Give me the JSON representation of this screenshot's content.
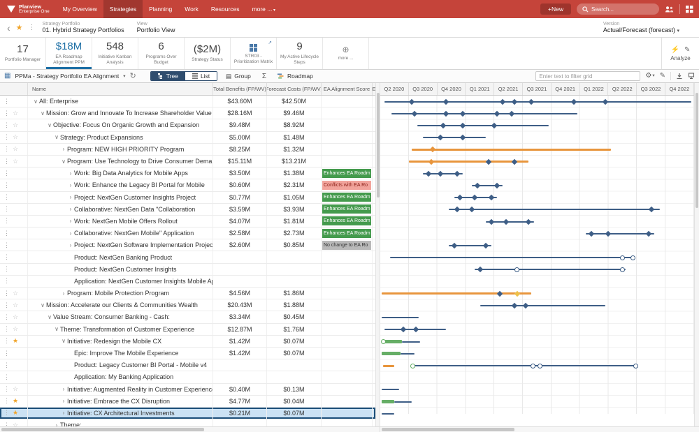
{
  "colors": {
    "nav_red": "#C5443A",
    "nav_red_dark": "#9E342C",
    "accent_blue": "#1D6FA5",
    "tree_active": "#2F4D6E",
    "selected_row_bg": "#CBE2F4",
    "selected_row_border": "#1C4F7A",
    "star_orange": "#F0A42A",
    "badge_green": "#449A4D",
    "badge_red": "#F2A49C",
    "badge_gray": "#B9B9B9",
    "navy": "#3E5E86",
    "orange": "#E8953C",
    "green": "#66AE66",
    "yellow": "#EEC04A"
  },
  "icons": {
    "kebab": "⋮",
    "star_filled": "★",
    "star_outline": "☆",
    "back": "‹",
    "caret_down": "▾",
    "expanded": "∨",
    "collapsed": "›",
    "refresh": "↻",
    "gear": "⚙",
    "pencil": "✎",
    "sigma": "Σ",
    "external": "↗",
    "plus_circle": "⊕",
    "grid": "▦",
    "group": "▤",
    "wand": "⚡"
  },
  "nav": {
    "logo_line1": "Planview",
    "logo_line2": "Enterprise One",
    "items": [
      {
        "label": "My Overview"
      },
      {
        "label": "Strategies",
        "active": true
      },
      {
        "label": "Planning"
      },
      {
        "label": "Work"
      },
      {
        "label": "Resources"
      },
      {
        "label": "more ...",
        "caret": true
      }
    ],
    "new_button": "+New",
    "search_placeholder": "Search..."
  },
  "breadcrumb": {
    "portfolio_label": "Strategy Portfolio",
    "portfolio_value": "01. Hybrid Strategy Portfolios",
    "view_label": "View",
    "view_value": "Portfolio View",
    "version_label": "Version",
    "version_value": "Actual/Forecast (forecast)"
  },
  "tiles": [
    {
      "value": "17",
      "label": "Portfolio Manager"
    },
    {
      "value": "$18M",
      "label": "EA Roadmap Alignment PPM",
      "selected": true
    },
    {
      "value": "548",
      "label": "Initiative Kanban Analysis"
    },
    {
      "value": "6",
      "label": "Programs Over Budget"
    },
    {
      "value": "($2M)",
      "label": "Strategy Status"
    },
    {
      "value": "",
      "label": "STR03 - Prioritization Matrix",
      "icon": "matrix"
    },
    {
      "value": "9",
      "label": "My Active Lifecycle Steps"
    },
    {
      "value": "",
      "label": "more ...",
      "icon": "plus"
    }
  ],
  "analyze_label": "Analyze",
  "toolbar": {
    "grid_view_label": "PPMa - Strategy Portfolio EA Alignment",
    "tree_label": "Tree",
    "list_label": "List",
    "group_label": "Group",
    "roadmap_label": "Roadmap",
    "filter_placeholder": "Enter text to filter grid"
  },
  "grid": {
    "columns": [
      "Name",
      "Total Benefits (FP/WV)",
      "Forecast Costs (FP/WV)",
      "EA Alignment Score",
      "E"
    ],
    "rows": [
      {
        "name": "All: Enterprise",
        "level": 0,
        "arrow": "v",
        "star": "none",
        "benefits": "$43.60M",
        "costs": "$42.50M",
        "ea": null
      },
      {
        "name": "Mission: Grow and Innovate To Increase Shareholder Value",
        "level": 1,
        "arrow": "v",
        "star": "outline",
        "benefits": "$28.16M",
        "costs": "$9.46M",
        "ea": null
      },
      {
        "name": "Objective: Focus On Organic Growth and Expansion",
        "level": 2,
        "arrow": "v",
        "star": "outline",
        "benefits": "$9.48M",
        "costs": "$8.92M",
        "ea": null
      },
      {
        "name": "Strategy: Product Expansions",
        "level": 3,
        "arrow": "v",
        "star": "outline",
        "benefits": "$5.00M",
        "costs": "$1.48M",
        "ea": null
      },
      {
        "name": "Program: NEW HIGH PRIORITY Program",
        "level": 4,
        "arrow": "r",
        "star": "outline",
        "benefits": "$8.25M",
        "costs": "$1.32M",
        "ea": null
      },
      {
        "name": "Program: Use Technology to Drive Consumer Demand",
        "level": 4,
        "arrow": "v",
        "star": "outline",
        "benefits": "$15.11M",
        "costs": "$13.21M",
        "ea": null
      },
      {
        "name": "Work: Big Data Analytics for Mobile Apps",
        "level": 5,
        "arrow": "r",
        "star": "none",
        "benefits": "$3.50M",
        "costs": "$1.38M",
        "ea": {
          "text": "Enhances EA Roadm",
          "kind": "green"
        }
      },
      {
        "name": "Work: Enhance the Legacy BI Portal for Mobile",
        "level": 5,
        "arrow": "r",
        "star": "none",
        "benefits": "$0.60M",
        "costs": "$2.31M",
        "ea": {
          "text": "Conflicts with EA Ro",
          "kind": "red"
        }
      },
      {
        "name": "Project: NextGen Customer Insights Project",
        "level": 5,
        "arrow": "r",
        "star": "none",
        "benefits": "$0.77M",
        "costs": "$1.05M",
        "ea": {
          "text": "Enhances EA Roadm",
          "kind": "green"
        }
      },
      {
        "name": "Collaborative: NextGen Data \"Collaboration",
        "level": 5,
        "arrow": "r",
        "star": "none",
        "benefits": "$3.59M",
        "costs": "$3.93M",
        "ea": {
          "text": "Enhances EA Roadm",
          "kind": "green"
        }
      },
      {
        "name": "Work: NextGen Mobile Offers Rollout",
        "level": 5,
        "arrow": "r",
        "star": "none",
        "benefits": "$4.07M",
        "costs": "$1.81M",
        "ea": {
          "text": "Enhances EA Roadm",
          "kind": "green"
        }
      },
      {
        "name": "Collaborative: NextGen Mobile\" Application",
        "level": 5,
        "arrow": "r",
        "star": "none",
        "benefits": "$2.58M",
        "costs": "$2.73M",
        "ea": {
          "text": "Enhances EA Roadm",
          "kind": "green"
        }
      },
      {
        "name": "Project: NextGen Software Implementation Project",
        "level": 5,
        "arrow": "r",
        "star": "none",
        "benefits": "$2.60M",
        "costs": "$0.85M",
        "ea": {
          "text": "No change to EA Ro",
          "kind": "gray"
        }
      },
      {
        "name": "Product: NextGen Banking Product",
        "level": 5,
        "arrow": "",
        "star": "none",
        "benefits": "",
        "costs": "",
        "ea": null
      },
      {
        "name": "Product: NextGen Customer Insights",
        "level": 5,
        "arrow": "",
        "star": "none",
        "benefits": "",
        "costs": "",
        "ea": null
      },
      {
        "name": "Application: NextGen Customer Insights Mobile App",
        "level": 5,
        "arrow": "",
        "star": "none",
        "benefits": "",
        "costs": "",
        "ea": null
      },
      {
        "name": "Program: Mobile Protection Program",
        "level": 4,
        "arrow": "r",
        "star": "outline",
        "benefits": "$4.56M",
        "costs": "$1.86M",
        "ea": null
      },
      {
        "name": "Mission: Accelerate our Clients & Communities Wealth",
        "level": 1,
        "arrow": "v",
        "star": "outline",
        "benefits": "$20.43M",
        "costs": "$1.88M",
        "ea": null
      },
      {
        "name": "Value Stream: Consumer Banking - Cash:",
        "level": 2,
        "arrow": "v",
        "star": "outline",
        "benefits": "$3.34M",
        "costs": "$0.45M",
        "ea": null
      },
      {
        "name": "Theme: Transformation of Customer Experience",
        "level": 3,
        "arrow": "v",
        "star": "outline",
        "benefits": "$12.87M",
        "costs": "$1.76M",
        "ea": null
      },
      {
        "name": "Initiative: Redesign the Mobile CX",
        "level": 4,
        "arrow": "v",
        "star": "filled",
        "benefits": "$1.42M",
        "costs": "$0.07M",
        "ea": null
      },
      {
        "name": "Epic: Improve The Mobile Experience",
        "level": 5,
        "arrow": "",
        "star": "none",
        "benefits": "$1.42M",
        "costs": "$0.07M",
        "ea": null
      },
      {
        "name": "Product: Legacy Customer BI Portal - Mobile v4",
        "level": 5,
        "arrow": "",
        "star": "none",
        "benefits": "",
        "costs": "",
        "ea": null
      },
      {
        "name": "Application: My Banking Application",
        "level": 5,
        "arrow": "",
        "star": "none",
        "benefits": "",
        "costs": "",
        "ea": null
      },
      {
        "name": "Initiative: Augmented Reality in Customer Experience",
        "level": 4,
        "arrow": "r",
        "star": "outline",
        "benefits": "$0.40M",
        "costs": "$0.13M",
        "ea": null
      },
      {
        "name": "Initiative: Embrace the CX Disruption",
        "level": 4,
        "arrow": "r",
        "star": "filled",
        "benefits": "$4.77M",
        "costs": "$0.04M",
        "ea": null
      },
      {
        "name": "Initiative: CX Architectural Investments",
        "level": 4,
        "arrow": "r",
        "star": "filled",
        "benefits": "$0.21M",
        "costs": "$0.07M",
        "ea": null,
        "selected": true
      },
      {
        "name": "Theme:",
        "level": 3,
        "arrow": "r",
        "star": "outline",
        "benefits": "",
        "costs": "",
        "ea": null
      }
    ]
  },
  "timeline": {
    "quarters": [
      "Q2 2020",
      "Q3 2020",
      "Q4 2020",
      "Q1 2021",
      "Q2 2021",
      "Q3 2021",
      "Q4 2021",
      "Q1 2022",
      "Q2 2022",
      "Q3 2022",
      "Q4 2022"
    ],
    "rows": [
      {
        "segments": [
          [
            0.15,
            10.9,
            "navy"
          ]
        ],
        "markers": [
          [
            1.1,
            "d",
            "navy"
          ],
          [
            2.3,
            "d",
            "navy"
          ],
          [
            4.3,
            "d",
            "navy"
          ],
          [
            4.7,
            "d",
            "navy"
          ],
          [
            5.3,
            "d",
            "navy"
          ],
          [
            6.8,
            "d",
            "navy"
          ],
          [
            7.9,
            "d",
            "navy"
          ]
        ]
      },
      {
        "segments": [
          [
            0.4,
            6.9,
            "navy"
          ]
        ],
        "markers": [
          [
            1.2,
            "d",
            "navy"
          ],
          [
            2.3,
            "d",
            "navy"
          ],
          [
            2.9,
            "d",
            "navy"
          ],
          [
            4.1,
            "d",
            "navy"
          ],
          [
            4.6,
            "d",
            "navy"
          ]
        ]
      },
      {
        "segments": [
          [
            1.3,
            5.9,
            "navy"
          ]
        ],
        "markers": [
          [
            2.2,
            "d",
            "navy"
          ],
          [
            2.9,
            "d",
            "navy"
          ],
          [
            4.0,
            "d",
            "navy"
          ]
        ]
      },
      {
        "segments": [
          [
            1.5,
            3.7,
            "navy"
          ]
        ],
        "markers": [
          [
            2.1,
            "d",
            "navy"
          ],
          [
            2.9,
            "d",
            "navy"
          ]
        ]
      },
      {
        "segments": [
          [
            1.1,
            8.1,
            "orange"
          ]
        ],
        "markers": [
          [
            1.85,
            "d",
            "orange"
          ]
        ]
      },
      {
        "segments": [
          [
            1.0,
            5.2,
            "orange"
          ]
        ],
        "markers": [
          [
            1.8,
            "d",
            "orange"
          ],
          [
            3.8,
            "d",
            "navy"
          ],
          [
            4.7,
            "d",
            "navy"
          ]
        ]
      },
      {
        "segments": [
          [
            1.5,
            2.9,
            "navy"
          ]
        ],
        "markers": [
          [
            1.7,
            "d",
            "navy"
          ],
          [
            2.1,
            "d",
            "navy"
          ],
          [
            2.7,
            "d",
            "navy"
          ]
        ]
      },
      {
        "segments": [
          [
            3.2,
            4.3,
            "navy"
          ]
        ],
        "markers": [
          [
            3.4,
            "d",
            "navy"
          ],
          [
            4.1,
            "d",
            "navy"
          ]
        ]
      },
      {
        "segments": [
          [
            2.6,
            4.1,
            "navy"
          ]
        ],
        "markers": [
          [
            2.8,
            "d",
            "navy"
          ],
          [
            3.3,
            "d",
            "navy"
          ],
          [
            3.9,
            "d",
            "navy"
          ]
        ]
      },
      {
        "segments": [
          [
            2.4,
            9.8,
            "navy"
          ]
        ],
        "markers": [
          [
            2.7,
            "d",
            "navy"
          ],
          [
            3.2,
            "d",
            "navy"
          ],
          [
            9.5,
            "d",
            "navy"
          ]
        ]
      },
      {
        "segments": [
          [
            3.7,
            5.4,
            "navy"
          ]
        ],
        "markers": [
          [
            3.9,
            "d",
            "navy"
          ],
          [
            4.4,
            "d",
            "navy"
          ],
          [
            5.2,
            "d",
            "navy"
          ]
        ]
      },
      {
        "segments": [
          [
            7.2,
            9.6,
            "navy"
          ]
        ],
        "markers": [
          [
            7.4,
            "d",
            "navy"
          ],
          [
            8.0,
            "d",
            "navy"
          ],
          [
            9.4,
            "d",
            "navy"
          ]
        ]
      },
      {
        "segments": [
          [
            2.4,
            3.9,
            "navy"
          ]
        ],
        "markers": [
          [
            2.6,
            "d",
            "navy"
          ],
          [
            3.7,
            "d",
            "navy"
          ]
        ]
      },
      {
        "segments": [
          [
            0.35,
            8.9,
            "navy"
          ]
        ],
        "markers": [
          [
            8.5,
            "c",
            "navy"
          ],
          [
            8.85,
            "c",
            "navy"
          ]
        ]
      },
      {
        "segments": [
          [
            3.3,
            8.6,
            "navy"
          ]
        ],
        "markers": [
          [
            3.5,
            "d",
            "navy"
          ],
          [
            4.8,
            "c",
            "navy"
          ],
          [
            8.5,
            "c",
            "navy"
          ]
        ]
      },
      {
        "segments": [],
        "markers": []
      },
      {
        "segments": [
          [
            0.05,
            5.3,
            "orange"
          ]
        ],
        "markers": [
          [
            4.2,
            "d",
            "navy"
          ],
          [
            4.8,
            "d",
            "yellow"
          ]
        ]
      },
      {
        "segments": [
          [
            3.5,
            7.9,
            "navy"
          ]
        ],
        "markers": [
          [
            4.7,
            "d",
            "navy"
          ],
          [
            5.1,
            "d",
            "navy"
          ]
        ]
      },
      {
        "segments": [
          [
            0.05,
            1.35,
            "navy"
          ]
        ],
        "markers": []
      },
      {
        "segments": [
          [
            0.15,
            2.3,
            "navy"
          ]
        ],
        "markers": [
          [
            0.8,
            "d",
            "navy"
          ],
          [
            1.25,
            "d",
            "navy"
          ]
        ]
      },
      {
        "segments": [
          [
            0.05,
            0.75,
            "green"
          ],
          [
            0.75,
            1.4,
            "navy"
          ]
        ],
        "markers": [
          [
            0.1,
            "c",
            "green"
          ]
        ]
      },
      {
        "segments": [
          [
            0.05,
            0.7,
            "green"
          ],
          [
            0.7,
            1.2,
            "navy"
          ]
        ],
        "markers": []
      },
      {
        "segments": [
          [
            0.1,
            0.5,
            "orange"
          ],
          [
            1.1,
            9.0,
            "navy"
          ]
        ],
        "markers": [
          [
            1.15,
            "c",
            "green"
          ],
          [
            5.35,
            "c",
            "navy"
          ],
          [
            5.6,
            "c",
            "navy"
          ],
          [
            8.95,
            "c",
            "navy"
          ]
        ]
      },
      {
        "segments": [],
        "markers": []
      },
      {
        "segments": [
          [
            0.05,
            0.65,
            "navy"
          ]
        ],
        "markers": []
      },
      {
        "segments": [
          [
            0.05,
            0.5,
            "green"
          ],
          [
            0.5,
            1.1,
            "navy"
          ]
        ],
        "markers": []
      },
      {
        "segments": [
          [
            0.05,
            0.5,
            "navy"
          ]
        ],
        "markers": []
      },
      {
        "segments": [],
        "markers": []
      }
    ]
  }
}
